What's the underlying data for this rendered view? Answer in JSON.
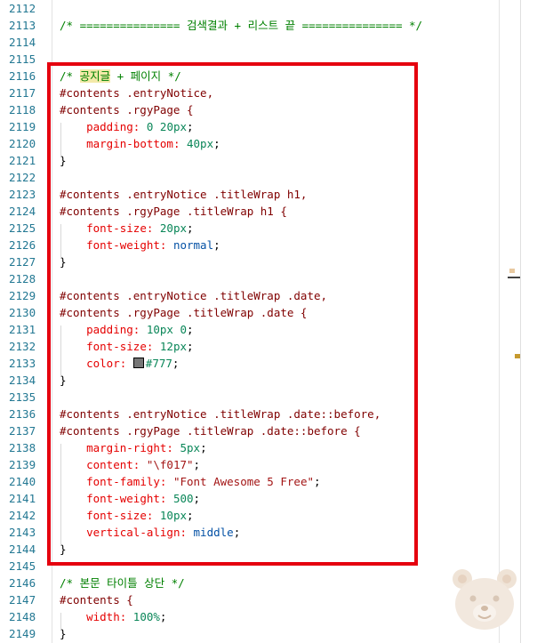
{
  "colors": {
    "comment": "#008000",
    "selector": "#800000",
    "property": "#e50000",
    "number": "#098658",
    "keyword": "#0451a5",
    "string": "#a31515",
    "line_number": "#237893",
    "annotation_box": "#e5000e",
    "swatch_777": "#777777"
  },
  "lines": [
    {
      "n": "2112",
      "tokens": []
    },
    {
      "n": "2113",
      "tokens": [
        {
          "t": "/* =============== 검색결과 + 리스트 끝 =============== */",
          "c": "comment"
        }
      ]
    },
    {
      "n": "2114",
      "tokens": []
    },
    {
      "n": "2115",
      "tokens": []
    },
    {
      "n": "2116",
      "tokens": [
        {
          "t": "/* ",
          "c": "comment"
        },
        {
          "t": "공지글",
          "c": "comment hl"
        },
        {
          "t": " + 페이지 */",
          "c": "comment"
        }
      ]
    },
    {
      "n": "2117",
      "tokens": [
        {
          "t": "#contents .entryNotice,",
          "c": "sel"
        }
      ]
    },
    {
      "n": "2118",
      "tokens": [
        {
          "t": "#contents .rgyPage {",
          "c": "sel"
        }
      ]
    },
    {
      "n": "2119",
      "tokens": [
        {
          "t": "    "
        },
        {
          "t": "padding:",
          "c": "prop"
        },
        {
          "t": " "
        },
        {
          "t": "0",
          "c": "val"
        },
        {
          "t": " "
        },
        {
          "t": "20px",
          "c": "val"
        },
        {
          "t": ";"
        }
      ]
    },
    {
      "n": "2120",
      "tokens": [
        {
          "t": "    "
        },
        {
          "t": "margin-bottom:",
          "c": "prop"
        },
        {
          "t": " "
        },
        {
          "t": "40px",
          "c": "val"
        },
        {
          "t": ";"
        }
      ]
    },
    {
      "n": "2121",
      "tokens": [
        {
          "t": "}"
        }
      ]
    },
    {
      "n": "2122",
      "tokens": []
    },
    {
      "n": "2123",
      "tokens": [
        {
          "t": "#contents .entryNotice .titleWrap h1,",
          "c": "sel"
        }
      ]
    },
    {
      "n": "2124",
      "tokens": [
        {
          "t": "#contents .rgyPage .titleWrap h1 {",
          "c": "sel"
        }
      ]
    },
    {
      "n": "2125",
      "tokens": [
        {
          "t": "    "
        },
        {
          "t": "font-size:",
          "c": "prop"
        },
        {
          "t": " "
        },
        {
          "t": "20px",
          "c": "val"
        },
        {
          "t": ";"
        }
      ]
    },
    {
      "n": "2126",
      "tokens": [
        {
          "t": "    "
        },
        {
          "t": "font-weight:",
          "c": "prop"
        },
        {
          "t": " "
        },
        {
          "t": "normal",
          "c": "kw"
        },
        {
          "t": ";"
        }
      ]
    },
    {
      "n": "2127",
      "tokens": [
        {
          "t": "}"
        }
      ]
    },
    {
      "n": "2128",
      "tokens": []
    },
    {
      "n": "2129",
      "tokens": [
        {
          "t": "#contents .entryNotice .titleWrap .date,",
          "c": "sel"
        }
      ]
    },
    {
      "n": "2130",
      "tokens": [
        {
          "t": "#contents .rgyPage .titleWrap .date {",
          "c": "sel"
        }
      ]
    },
    {
      "n": "2131",
      "tokens": [
        {
          "t": "    "
        },
        {
          "t": "padding:",
          "c": "prop"
        },
        {
          "t": " "
        },
        {
          "t": "10px",
          "c": "val"
        },
        {
          "t": " "
        },
        {
          "t": "0",
          "c": "val"
        },
        {
          "t": ";"
        }
      ]
    },
    {
      "n": "2132",
      "tokens": [
        {
          "t": "    "
        },
        {
          "t": "font-size:",
          "c": "prop"
        },
        {
          "t": " "
        },
        {
          "t": "12px",
          "c": "val"
        },
        {
          "t": ";"
        }
      ]
    },
    {
      "n": "2133",
      "tokens": [
        {
          "t": "    "
        },
        {
          "t": "color:",
          "c": "prop"
        },
        {
          "t": " "
        },
        {
          "t": "",
          "c": "swatch"
        },
        {
          "t": "#777",
          "c": "val"
        },
        {
          "t": ";"
        }
      ]
    },
    {
      "n": "2134",
      "tokens": [
        {
          "t": "}"
        }
      ]
    },
    {
      "n": "2135",
      "tokens": []
    },
    {
      "n": "2136",
      "tokens": [
        {
          "t": "#contents .entryNotice .titleWrap .date::before,",
          "c": "sel"
        }
      ]
    },
    {
      "n": "2137",
      "tokens": [
        {
          "t": "#contents .rgyPage .titleWrap .date::before {",
          "c": "sel"
        }
      ]
    },
    {
      "n": "2138",
      "tokens": [
        {
          "t": "    "
        },
        {
          "t": "margin-right:",
          "c": "prop"
        },
        {
          "t": " "
        },
        {
          "t": "5px",
          "c": "val"
        },
        {
          "t": ";"
        }
      ]
    },
    {
      "n": "2139",
      "tokens": [
        {
          "t": "    "
        },
        {
          "t": "content:",
          "c": "prop"
        },
        {
          "t": " "
        },
        {
          "t": "\"\\f017\"",
          "c": "str"
        },
        {
          "t": ";"
        }
      ]
    },
    {
      "n": "2140",
      "tokens": [
        {
          "t": "    "
        },
        {
          "t": "font-family:",
          "c": "prop"
        },
        {
          "t": " "
        },
        {
          "t": "\"Font Awesome 5 Free\"",
          "c": "str"
        },
        {
          "t": ";"
        }
      ]
    },
    {
      "n": "2141",
      "tokens": [
        {
          "t": "    "
        },
        {
          "t": "font-weight:",
          "c": "prop"
        },
        {
          "t": " "
        },
        {
          "t": "500",
          "c": "val"
        },
        {
          "t": ";"
        }
      ]
    },
    {
      "n": "2142",
      "tokens": [
        {
          "t": "    "
        },
        {
          "t": "font-size:",
          "c": "prop"
        },
        {
          "t": " "
        },
        {
          "t": "10px",
          "c": "val"
        },
        {
          "t": ";"
        }
      ]
    },
    {
      "n": "2143",
      "tokens": [
        {
          "t": "    "
        },
        {
          "t": "vertical-align:",
          "c": "prop"
        },
        {
          "t": " "
        },
        {
          "t": "middle",
          "c": "kw"
        },
        {
          "t": ";"
        }
      ]
    },
    {
      "n": "2144",
      "tokens": [
        {
          "t": "}"
        }
      ]
    },
    {
      "n": "2145",
      "tokens": []
    },
    {
      "n": "2146",
      "tokens": [
        {
          "t": "/* 본문 타이틀 상단 */",
          "c": "comment"
        }
      ]
    },
    {
      "n": "2147",
      "tokens": [
        {
          "t": "#contents {",
          "c": "sel"
        }
      ]
    },
    {
      "n": "2148",
      "tokens": [
        {
          "t": "    "
        },
        {
          "t": "width:",
          "c": "prop"
        },
        {
          "t": " "
        },
        {
          "t": "100%",
          "c": "val"
        },
        {
          "t": ";"
        }
      ]
    },
    {
      "n": "2149",
      "tokens": [
        {
          "t": "}"
        }
      ]
    }
  ],
  "icons": {
    "mascot": "bear-mascot-icon",
    "color_swatch": "color-swatch-icon"
  }
}
